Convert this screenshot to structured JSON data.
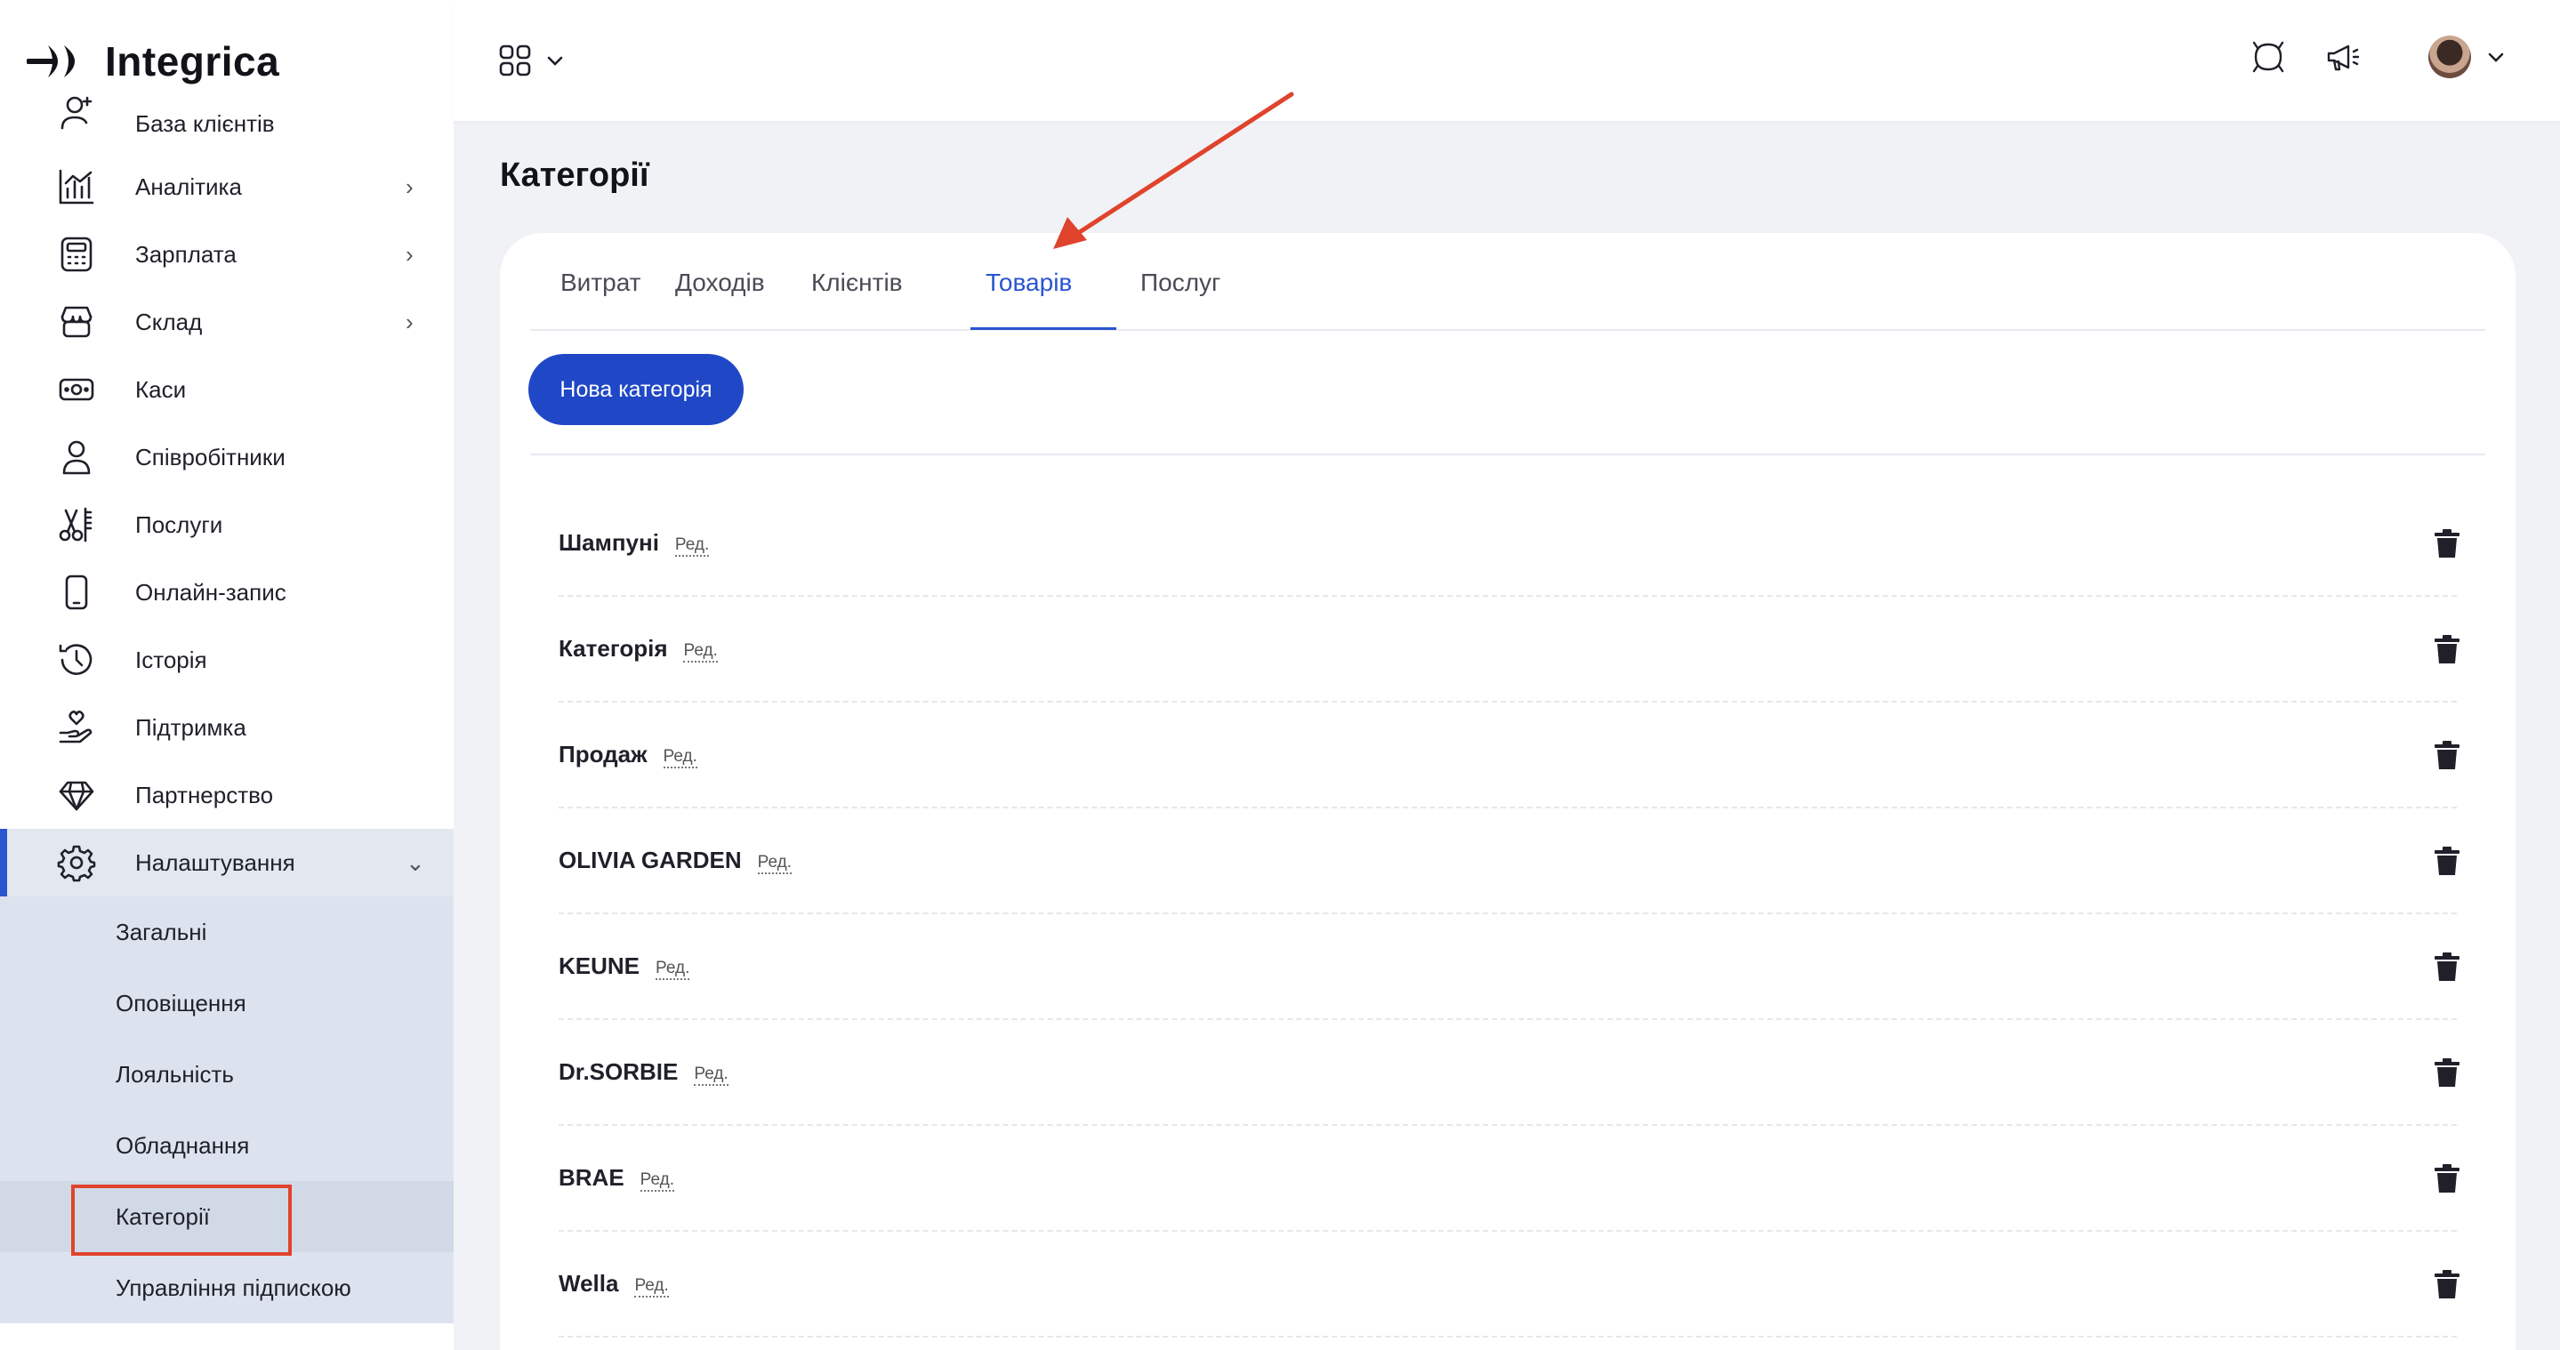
{
  "app": {
    "name": "Integrica"
  },
  "sidebar": {
    "items": [
      {
        "label": "База клієнтів",
        "icon": "clients-icon",
        "chevron": ""
      },
      {
        "label": "Аналітика",
        "icon": "analytics-icon",
        "chevron": "›"
      },
      {
        "label": "Зарплата",
        "icon": "calculator-icon",
        "chevron": "›"
      },
      {
        "label": "Склад",
        "icon": "store-icon",
        "chevron": "›"
      },
      {
        "label": "Каси",
        "icon": "cash-icon",
        "chevron": ""
      },
      {
        "label": "Співробітники",
        "icon": "user-icon",
        "chevron": ""
      },
      {
        "label": "Послуги",
        "icon": "scissors-icon",
        "chevron": ""
      },
      {
        "label": "Онлайн-запис",
        "icon": "phone-icon",
        "chevron": ""
      },
      {
        "label": "Історія",
        "icon": "history-icon",
        "chevron": ""
      },
      {
        "label": "Підтримка",
        "icon": "support-icon",
        "chevron": ""
      },
      {
        "label": "Партнерство",
        "icon": "diamond-icon",
        "chevron": ""
      },
      {
        "label": "Налаштування",
        "icon": "gear-icon",
        "chevron": "⌄"
      }
    ],
    "settings_sub": [
      {
        "label": "Загальні"
      },
      {
        "label": "Оповіщення"
      },
      {
        "label": "Лояльність"
      },
      {
        "label": "Обладнання"
      },
      {
        "label": "Категорії"
      },
      {
        "label": "Управління підпискою"
      }
    ]
  },
  "topbar": {
    "apps_icon": "grid-icon",
    "icons": [
      "support-chat-icon",
      "megaphone-icon"
    ],
    "avatar": "user-avatar"
  },
  "main": {
    "title": "Категорії",
    "tabs": [
      {
        "label": "Витрат"
      },
      {
        "label": "Доходів"
      },
      {
        "label": "Клієнтів"
      },
      {
        "label": "Товарів"
      },
      {
        "label": "Послуг"
      }
    ],
    "active_tab": "Товарів",
    "new_button": "Нова категорія",
    "edit_label": "Ред.",
    "categories": [
      {
        "name": "Шампуні"
      },
      {
        "name": "Категорія"
      },
      {
        "name": "Продаж"
      },
      {
        "name": "OLIVIA GARDEN"
      },
      {
        "name": "KEUNE"
      },
      {
        "name": "Dr.SORBIE"
      },
      {
        "name": "BRAE"
      },
      {
        "name": "Wella"
      }
    ]
  },
  "colors": {
    "accent": "#2a55d0",
    "button": "#2048c6",
    "annotation": "#e0432c"
  }
}
